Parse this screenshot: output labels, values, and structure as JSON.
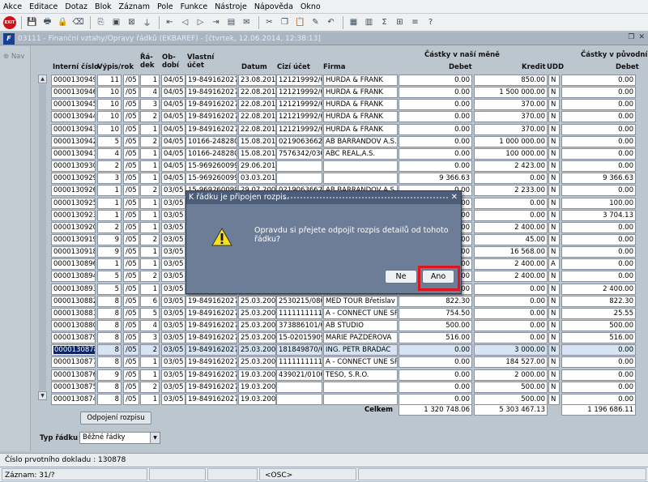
{
  "menu": [
    "Akce",
    "Editace",
    "Dotaz",
    "Blok",
    "Záznam",
    "Pole",
    "Funkce",
    "Nástroje",
    "Nápověda",
    "Okno"
  ],
  "toolbar_icons": [
    "exit-icon",
    "save-icon",
    "print-icon",
    "lock-icon",
    "clear-icon",
    "copy-icon",
    "insert-record-icon",
    "delete-record-icon",
    "filter-icon",
    "first-record-icon",
    "previous-record-icon",
    "next-record-icon",
    "last-record-icon",
    "report-icon",
    "mail-icon",
    "cut-icon",
    "copy-text-icon",
    "paste-icon",
    "edit-icon",
    "undo-icon",
    "calendar-icon",
    "calculator-icon",
    "sum-icon",
    "excel-icon",
    "list-icon",
    "help-icon"
  ],
  "window": {
    "icon": "F",
    "title": "03111 - Finanční vztahy/Opravy řádků (EKBAREF) - [čtvrtek, 12.06.2014, 12:38:13]"
  },
  "nav": {
    "label": "Nav"
  },
  "headers": {
    "interni_cislo": "Interní číslo",
    "vypis_rok": "Výpis/rok",
    "radek": "Řá-dek",
    "obdobi": "Ob-dobí",
    "vlastni_ucet": "Vlastní účet",
    "datum": "Datum",
    "cizi_ucet": "Cizí účet",
    "firma": "Firma",
    "castky_nasi": "Částky v naší měně",
    "debet": "Debet",
    "kredit": "Kredit",
    "udd": "UDD",
    "castky_puvodni": "Částky v původní",
    "debet2": "Debet"
  },
  "rows": [
    {
      "id": "0000130949",
      "vypis": "11",
      "rok": "05",
      "radek": "1",
      "obdobi": "04/05",
      "vlastni": "19-8491620277",
      "datum": "23.08.2012",
      "cizi": "121219992/03",
      "firma": "HURDA & FRANK",
      "debet": "0.00",
      "kredit": "850.00",
      "udd": "N",
      "debet2": "0.00"
    },
    {
      "id": "0000130946",
      "vypis": "10",
      "rok": "05",
      "radek": "4",
      "obdobi": "04/05",
      "vlastni": "19-8491620277",
      "datum": "22.08.2012",
      "cizi": "121219992/03",
      "firma": "HURDA & FRANK",
      "debet": "0.00",
      "kredit": "1 500 000.00",
      "udd": "N",
      "debet2": "0.00"
    },
    {
      "id": "0000130945",
      "vypis": "10",
      "rok": "05",
      "radek": "3",
      "obdobi": "04/05",
      "vlastni": "19-8491620277",
      "datum": "22.08.2012",
      "cizi": "121219992/03",
      "firma": "HURDA & FRANK",
      "debet": "0.00",
      "kredit": "370.00",
      "udd": "N",
      "debet2": "0.00"
    },
    {
      "id": "0000130944",
      "vypis": "10",
      "rok": "05",
      "radek": "2",
      "obdobi": "04/05",
      "vlastni": "19-8491620277",
      "datum": "22.08.2012",
      "cizi": "121219992/03",
      "firma": "HURDA & FRANK",
      "debet": "0.00",
      "kredit": "370.00",
      "udd": "N",
      "debet2": "0.00"
    },
    {
      "id": "0000130943",
      "vypis": "10",
      "rok": "05",
      "radek": "1",
      "obdobi": "04/05",
      "vlastni": "19-8491620277",
      "datum": "22.08.2012",
      "cizi": "121219992/03",
      "firma": "HURDA & FRANK",
      "debet": "0.00",
      "kredit": "370.00",
      "udd": "N",
      "debet2": "0.00"
    },
    {
      "id": "0000130942",
      "vypis": "5",
      "rok": "05",
      "radek": "2",
      "obdobi": "04/05",
      "vlastni": "10166-2482809",
      "datum": "15.08.2012",
      "cizi": "0219063662/0",
      "firma": "AB BARRANDOV A.S.",
      "debet": "0.00",
      "kredit": "1 000 000.00",
      "udd": "N",
      "debet2": "0.00"
    },
    {
      "id": "0000130941",
      "vypis": "4",
      "rok": "05",
      "radek": "1",
      "obdobi": "04/05",
      "vlastni": "10166-2482809",
      "datum": "15.08.2012",
      "cizi": "7576342/0300",
      "firma": "ABC REAL,A.S.",
      "debet": "0.00",
      "kredit": "100 000.00",
      "udd": "N",
      "debet2": "0.00"
    },
    {
      "id": "0000130930",
      "vypis": "2",
      "rok": "05",
      "radek": "1",
      "obdobi": "04/05",
      "vlastni": "15-9692600994",
      "datum": "29.06.2011",
      "cizi": "",
      "firma": "",
      "debet": "0.00",
      "kredit": "2 423.00",
      "udd": "N",
      "debet2": "0.00"
    },
    {
      "id": "0000130929",
      "vypis": "3",
      "rok": "05",
      "radek": "1",
      "obdobi": "04/05",
      "vlastni": "15-9692600994",
      "datum": "03.03.2011",
      "cizi": "",
      "firma": "",
      "debet": "9 366.63",
      "kredit": "0.00",
      "udd": "N",
      "debet2": "9 366.63"
    },
    {
      "id": "0000130926",
      "vypis": "1",
      "rok": "05",
      "radek": "2",
      "obdobi": "03/05",
      "vlastni": "15-9692600994",
      "datum": "29.07.2009",
      "cizi": "0219063662/0",
      "firma": "AB BARRANDOV A.S.",
      "debet": "0.00",
      "kredit": "2 233.00",
      "udd": "N",
      "debet2": "0.00"
    },
    {
      "id": "0000130925",
      "vypis": "1",
      "rok": "05",
      "radek": "1",
      "obdobi": "03/05",
      "vlastni": "",
      "datum": "",
      "cizi": "",
      "firma": "",
      "debet": "0.00",
      "kredit": "0.00",
      "udd": "N",
      "debet2": "100.00"
    },
    {
      "id": "0000130923",
      "vypis": "1",
      "rok": "05",
      "radek": "1",
      "obdobi": "03/05",
      "vlastni": "",
      "datum": "",
      "cizi": "",
      "firma": "",
      "debet": "0.00",
      "kredit": "0.00",
      "udd": "N",
      "debet2": "3 704.13"
    },
    {
      "id": "0000130920",
      "vypis": "2",
      "rok": "05",
      "radek": "1",
      "obdobi": "03/05",
      "vlastni": "",
      "datum": "",
      "cizi": "",
      "firma": "",
      "debet": "0.00",
      "kredit": "2 400.00",
      "udd": "N",
      "debet2": "0.00"
    },
    {
      "id": "0000130919",
      "vypis": "9",
      "rok": "05",
      "radek": "2",
      "obdobi": "03/05",
      "vlastni": "",
      "datum": "",
      "cizi": "",
      "firma": "",
      "debet": "0.00",
      "kredit": "45.00",
      "udd": "N",
      "debet2": "0.00"
    },
    {
      "id": "0000130918",
      "vypis": "9",
      "rok": "05",
      "radek": "1",
      "obdobi": "03/05",
      "vlastni": "",
      "datum": "",
      "cizi": "",
      "firma": "",
      "debet": "0.00",
      "kredit": "16 568.00",
      "udd": "N",
      "debet2": "0.00"
    },
    {
      "id": "0000130896",
      "vypis": "1",
      "rok": "05",
      "radek": "1",
      "obdobi": "03/05",
      "vlastni": "",
      "datum": "",
      "cizi": "",
      "firma": "",
      "debet": "0.00",
      "kredit": "2 400.00",
      "udd": "A",
      "debet2": "0.00"
    },
    {
      "id": "0000130894",
      "vypis": "5",
      "rok": "05",
      "radek": "2",
      "obdobi": "03/05",
      "vlastni": "",
      "datum": "",
      "cizi": "",
      "firma": "",
      "debet": "0.00",
      "kredit": "2 400.00",
      "udd": "N",
      "debet2": "0.00"
    },
    {
      "id": "0000130893",
      "vypis": "5",
      "rok": "05",
      "radek": "1",
      "obdobi": "03/05",
      "vlastni": "",
      "datum": "",
      "cizi": "",
      "firma": "",
      "debet": "0.00",
      "kredit": "0.00",
      "udd": "N",
      "debet2": "2 400.00"
    },
    {
      "id": "0000130882",
      "vypis": "8",
      "rok": "05",
      "radek": "6",
      "obdobi": "03/05",
      "vlastni": "19-8491620277",
      "datum": "25.03.2009",
      "cizi": "2530215/0800",
      "firma": "MED TOUR Břetislav Le",
      "debet": "822.30",
      "kredit": "0.00",
      "udd": "N",
      "debet2": "822.30"
    },
    {
      "id": "0000130881",
      "vypis": "8",
      "rok": "05",
      "radek": "5",
      "obdobi": "03/05",
      "vlastni": "19-8491620277",
      "datum": "25.03.2009",
      "cizi": "1111111111/0",
      "firma": "A - CONNECT UNE SPO",
      "debet": "754.50",
      "kredit": "0.00",
      "udd": "N",
      "debet2": "25.55"
    },
    {
      "id": "0000130880",
      "vypis": "8",
      "rok": "05",
      "radek": "4",
      "obdobi": "03/05",
      "vlastni": "19-8491620277",
      "datum": "25.03.2009",
      "cizi": "373886101/01",
      "firma": "AB STUDIO",
      "debet": "500.00",
      "kredit": "0.00",
      "udd": "N",
      "debet2": "500.00"
    },
    {
      "id": "0000130879",
      "vypis": "8",
      "rok": "05",
      "radek": "3",
      "obdobi": "03/05",
      "vlastni": "19-8491620277",
      "datum": "25.03.2009",
      "cizi": "15-02015909",
      "firma": "MARIE PAZDEROVA",
      "debet": "516.00",
      "kredit": "0.00",
      "udd": "N",
      "debet2": "516.00"
    },
    {
      "id": "0000130878",
      "vypis": "8",
      "rok": "05",
      "radek": "2",
      "obdobi": "03/05",
      "vlastni": "19-8491620277",
      "datum": "25.03.2009",
      "cizi": "181849870/01",
      "firma": "ING. PETR BRADAC",
      "debet": "0.00",
      "kredit": "3 000.00",
      "udd": "N",
      "debet2": "0.00",
      "selected": true
    },
    {
      "id": "0000130877",
      "vypis": "8",
      "rok": "05",
      "radek": "1",
      "obdobi": "03/05",
      "vlastni": "19-8491620277",
      "datum": "25.03.2009",
      "cizi": "1111111111/0",
      "firma": "A - CONNECT UNE SPO",
      "debet": "0.00",
      "kredit": "184 527.00",
      "udd": "N",
      "debet2": "0.00"
    },
    {
      "id": "0000130876",
      "vypis": "9",
      "rok": "05",
      "radek": "1",
      "obdobi": "03/05",
      "vlastni": "19-8491620277",
      "datum": "19.03.2009",
      "cizi": "439021/0100",
      "firma": "TESO, S.R.O.",
      "debet": "0.00",
      "kredit": "2 000.00",
      "udd": "N",
      "debet2": "0.00"
    },
    {
      "id": "0000130875",
      "vypis": "8",
      "rok": "05",
      "radek": "2",
      "obdobi": "03/05",
      "vlastni": "19-8491620277",
      "datum": "19.03.2009",
      "cizi": "",
      "firma": "",
      "debet": "0.00",
      "kredit": "500.00",
      "udd": "N",
      "debet2": "0.00"
    },
    {
      "id": "0000130874",
      "vypis": "8",
      "rok": "05",
      "radek": "1",
      "obdobi": "03/05",
      "vlastni": "19-8491620277",
      "datum": "19.03.2009",
      "cizi": "",
      "firma": "",
      "debet": "0.00",
      "kredit": "500.00",
      "udd": "N",
      "debet2": "0.00"
    }
  ],
  "totals": {
    "label": "Celkem",
    "debet": "1 320 748.06",
    "kredit": "5 303 467.13",
    "debet2": "1 196 686.11"
  },
  "odpojeni_button": "Odpojení rozpisu",
  "typ_radku": {
    "label": "Typ řádku",
    "value": "Běžné řádky"
  },
  "status": {
    "line1": "Číslo prvotního dokladu : 130878",
    "zaznam": "Záznam: 31/?",
    "osc": "<OSC>"
  },
  "dialog": {
    "title": "K řádku je připojen rozpis.",
    "message": "Opravdu si přejete odpojit rozpis detailů od tohoto řádku?",
    "no_label": "Ne",
    "yes_label": "Ano"
  }
}
